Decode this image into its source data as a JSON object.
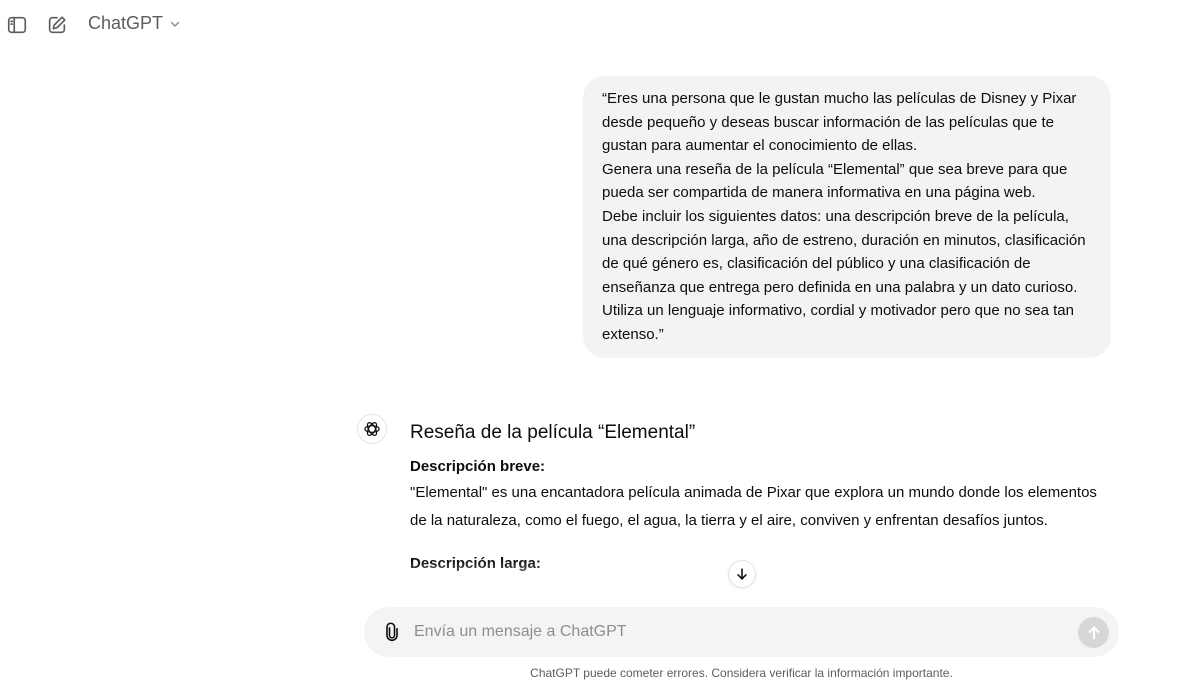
{
  "header": {
    "sidebar_icon": "sidebar-toggle-icon",
    "new_chat_icon": "new-chat-icon",
    "model_name": "ChatGPT"
  },
  "conversation": {
    "user_message": {
      "lines": [
        "“Eres una persona que le gustan mucho las películas de Disney y Pixar desde pequeño y deseas buscar información de las películas que te gustan para aumentar el conocimiento de ellas.",
        "Genera una reseña de la película “Elemental” que sea breve para que pueda ser compartida de manera informativa en una página web.",
        "Debe incluir los siguientes datos: una descripción breve de la película, una descripción larga, año de estreno, duración en minutos, clasificación de qué género es, clasificación del público y una clasificación de enseñanza que entrega pero definida en una palabra y un dato curioso.",
        "Utiliza un lenguaje informativo, cordial y motivador pero que no sea tan extenso.”"
      ]
    },
    "assistant_message": {
      "title": "Reseña de la película “Elemental”",
      "short_heading": "Descripción breve:",
      "short_text": "\"Elemental\" es una encantadora película animada de Pixar que explora un mundo donde los elementos de la naturaleza, como el fuego, el agua, la tierra y el aire, conviven y enfrentan desafíos juntos.",
      "long_heading": "Descripción larga:"
    }
  },
  "composer": {
    "placeholder": "Envía un mensaje a ChatGPT",
    "attach_icon": "paperclip-icon",
    "send_icon": "arrow-up-icon"
  },
  "footer": {
    "disclaimer": "ChatGPT puede cometer errores. Considera verificar la información importante."
  },
  "colors": {
    "bubble_bg": "#f3f3f4",
    "composer_bg": "#f4f4f4",
    "send_disabled": "#d7d7d7",
    "text": "#0d0d0d",
    "muted": "#5d5d5d"
  }
}
